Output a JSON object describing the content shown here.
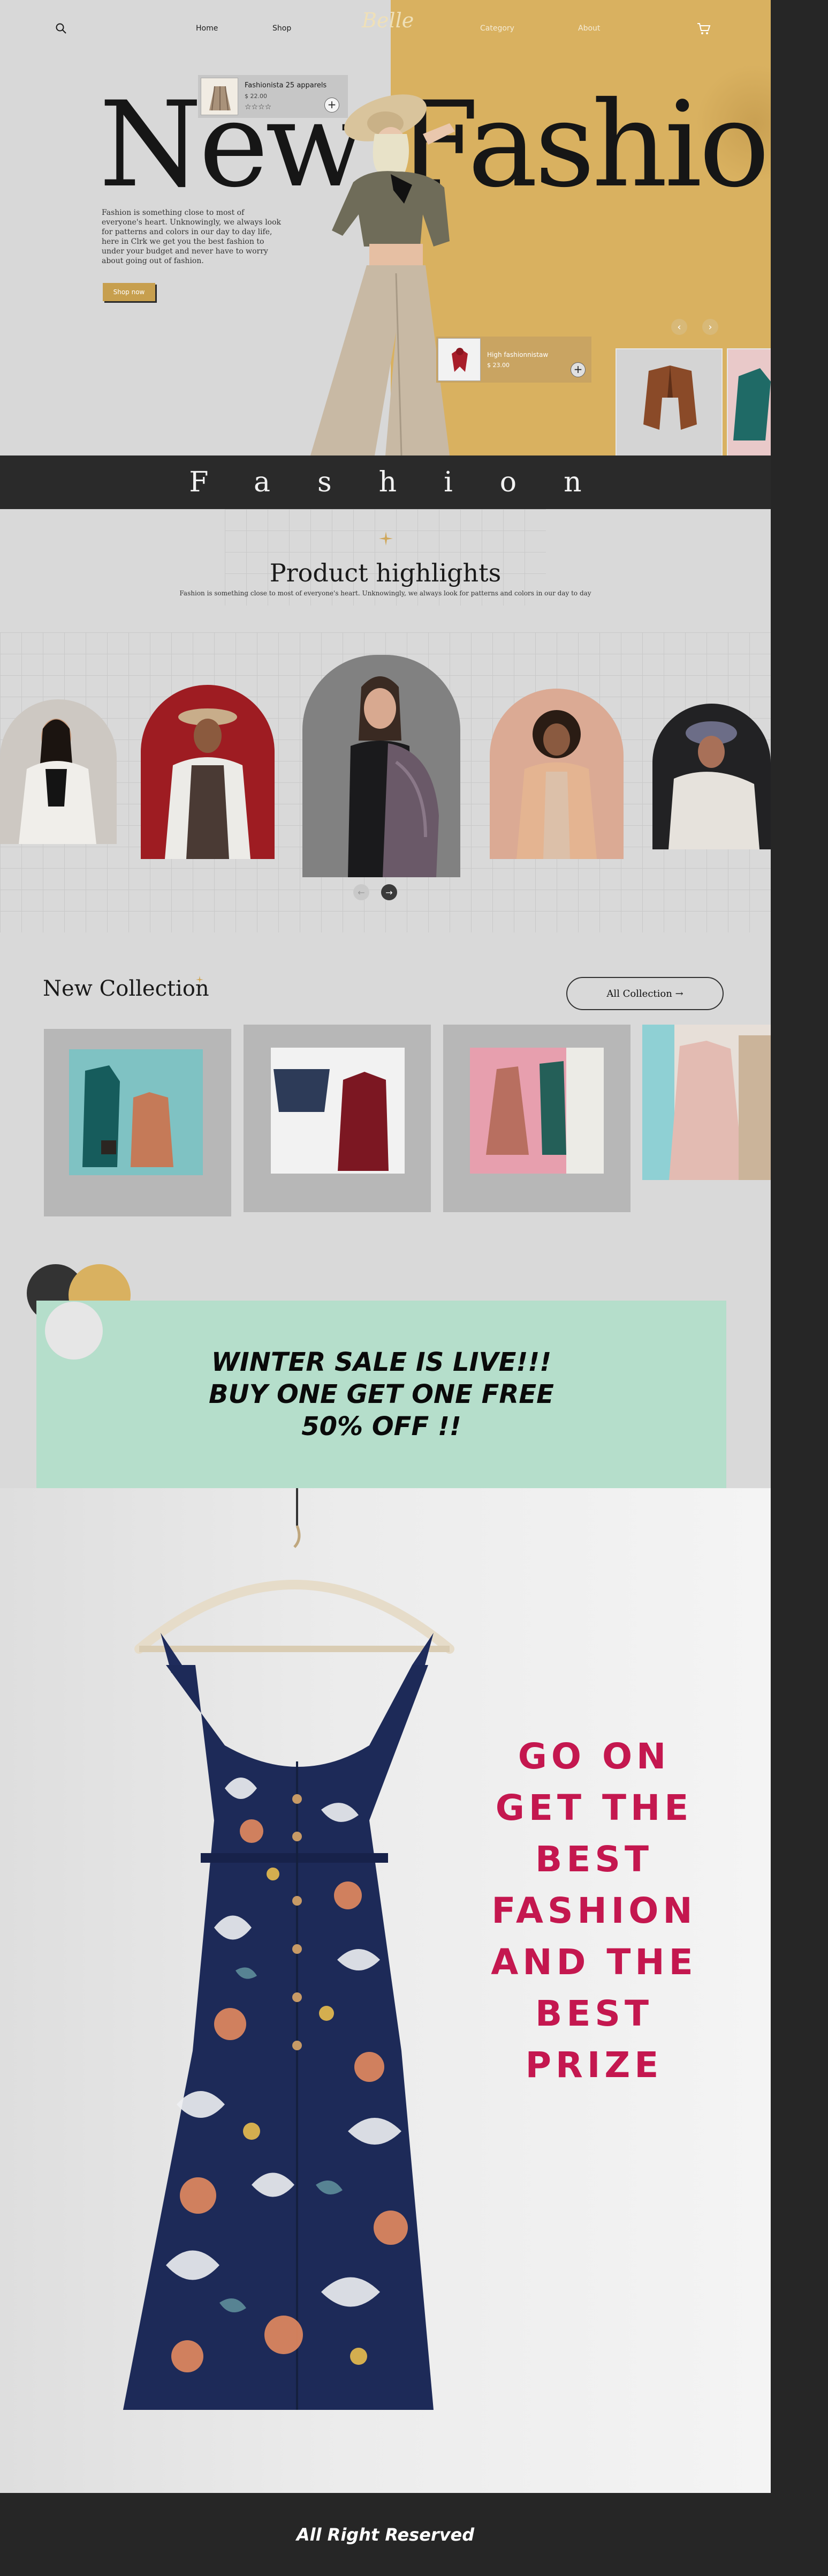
{
  "nav": {
    "home": "Home",
    "shop": "Shop",
    "logo": "Belle",
    "category": "Category",
    "about": "About"
  },
  "hero": {
    "title": "New Fashion",
    "description": "Fashion is something close to most of everyone's heart. Unknowingly, we always look for patterns and colors in our day to day life, here in Clrk we get you the best fashion to under your budget and never have to worry about going out of fashion.",
    "shop_button": "Shop now",
    "product_top": {
      "name": "Fashionista 25 apparels",
      "price": "$ 22.00",
      "stars": "☆☆☆☆",
      "rating": 0
    },
    "product_bottom": {
      "name": "High fashionnistaw",
      "price": "$ 23.00"
    },
    "plus_symbol": "+"
  },
  "band": {
    "text": "Fashion"
  },
  "highlights": {
    "title": "Product highlights",
    "subtitle": "Fashion is something close to most of everyone's heart. Unknowingly, we always look for patterns and colors in our day to day"
  },
  "collection": {
    "title": "New Collection",
    "button": "All Collection →"
  },
  "promo": {
    "line1": "WINTER SALE IS LIVE!!!",
    "line2": "BUY ONE GET ONE FREE",
    "line3": "50% OFF !!"
  },
  "dress_section": {
    "lines": [
      "GO ON",
      "GET THE",
      "BEST",
      "FASHION",
      "AND THE",
      "BEST",
      "PRIZE"
    ]
  },
  "footer": {
    "text": "All Right Reserved"
  },
  "colors": {
    "gold": "#d9b160",
    "dark": "#262626",
    "mint": "#b5decb",
    "crimson": "#c4174f"
  },
  "icons": [
    "search-icon",
    "cart-icon",
    "plus-icon",
    "arrow-left-icon",
    "arrow-right-icon",
    "sparkle-icon"
  ]
}
